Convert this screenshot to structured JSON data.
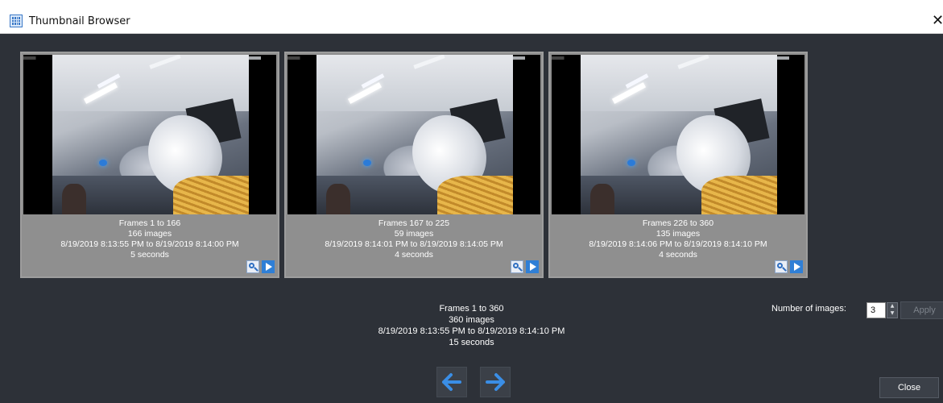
{
  "window": {
    "title": "Thumbnail Browser",
    "close_glyph": "✕",
    "icon": "thumbnail-grid-icon"
  },
  "thumbnails": [
    {
      "frames": "Frames 1 to 166",
      "images": "166 images",
      "range": "8/19/2019 8:13:55 PM to 8/19/2019 8:14:00 PM",
      "duration": "5 seconds"
    },
    {
      "frames": "Frames 167 to 225",
      "images": "59 images",
      "range": "8/19/2019 8:14:01 PM to 8/19/2019 8:14:05 PM",
      "duration": "4 seconds"
    },
    {
      "frames": "Frames 226 to 360",
      "images": "135 images",
      "range": "8/19/2019 8:14:06 PM to 8/19/2019 8:14:10 PM",
      "duration": "4 seconds"
    }
  ],
  "summary": {
    "frames": "Frames 1 to 360",
    "images": "360 images",
    "range": "8/19/2019 8:13:55 PM to 8/19/2019 8:14:10 PM",
    "duration": "15 seconds"
  },
  "navigation": {
    "prev_glyph": "🡐",
    "next_glyph": "🡒"
  },
  "controls": {
    "number_of_images_label": "Number of images:",
    "number_of_images_value": "3",
    "spin_up": "▲",
    "spin_down": "▼",
    "apply_label": "Apply",
    "close_label": "Close"
  },
  "colors": {
    "background": "#2d3138",
    "thumb_panel": "#8f8f8f",
    "accent_blue": "#2f7fd6"
  }
}
